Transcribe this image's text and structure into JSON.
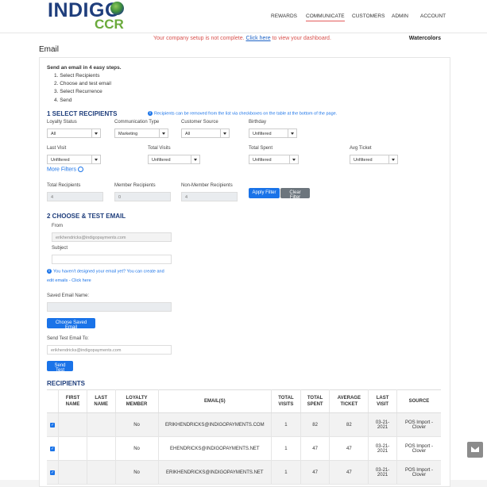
{
  "brand": {
    "name": "INDIGO",
    "sub": "CCR"
  },
  "nav": [
    {
      "label": "REWARDS"
    },
    {
      "label": "COMMUNICATE"
    },
    {
      "label": "CUSTOMERS"
    },
    {
      "label": "ADMIN"
    },
    {
      "label": "ACCOUNT"
    }
  ],
  "warning": {
    "text": "Your company setup is not complete.",
    "link": "Click here",
    "suffix": "to view your dashboard."
  },
  "company": "Watercolors",
  "page_title": "Email",
  "intro": {
    "heading": "Send an email in 4 easy steps.",
    "steps": [
      "1. Select Recipients",
      "2. Choose and test email",
      "3. Select Recurrence",
      "4. Send"
    ]
  },
  "section1": {
    "title": "1 SELECT RECIPIENTS",
    "note": "Recipients can be removed from the list via checkboxes on the table at the bottom of the page.",
    "filters": [
      {
        "label": "Loyalty Status",
        "value": "All"
      },
      {
        "label": "Communication Type",
        "value": "Marketing"
      },
      {
        "label": "Customer Source",
        "value": "All"
      },
      {
        "label": "Birthday",
        "value": "Unfiltered"
      },
      {
        "label": "Last Visit",
        "value": "Unfiltered"
      },
      {
        "label": "Total Visits",
        "value": "Unfiltered"
      },
      {
        "label": "Total Spent",
        "value": "Unfiltered"
      },
      {
        "label": "Avg Ticket",
        "value": "Unfiltered"
      }
    ],
    "more_filters": "More Filters",
    "counts": [
      {
        "label": "Total Recipients",
        "value": "4"
      },
      {
        "label": "Member Recipients",
        "value": "0"
      },
      {
        "label": "Non-Member Recipients",
        "value": "4"
      }
    ],
    "apply": "Apply Filter",
    "clear": "Clear Filter"
  },
  "section2": {
    "title": "2 CHOOSE & TEST EMAIL",
    "from_label": "From",
    "from_value": "erikhendricks@indigopayments.com",
    "subject_label": "Subject",
    "subject_value": "",
    "hint": "You haven't designed your email yet? You can create and",
    "hint2": "edit emails - Click here",
    "saved_label": "Saved Email Name:",
    "saved_value": "",
    "choose_btn": "Choose Saved Email",
    "test_label": "Send Test Email To:",
    "test_value": "erikhendricks@indigopayments.com",
    "send_test_btn": "Send Test"
  },
  "recipients": {
    "title": "RECIPIENTS",
    "columns": [
      "",
      "FIRST NAME",
      "LAST NAME",
      "LOYALTY MEMBER",
      "EMAIL(S)",
      "TOTAL VISITS",
      "TOTAL SPENT",
      "AVERAGE TICKET",
      "LAST VISIT",
      "SOURCE"
    ],
    "rows": [
      {
        "first": "",
        "last": "",
        "member": "No",
        "email": "ERIKHENDRICKS@INDIGOPAYMENTS.COM",
        "visits": "1",
        "spent": "82",
        "avg": "82",
        "last_visit": "03-21-2021",
        "source": "POS Import - Clover"
      },
      {
        "first": "",
        "last": "",
        "member": "No",
        "email": "EHENDRICKS@INDIGOPAYMENTS.NET",
        "visits": "1",
        "spent": "47",
        "avg": "47",
        "last_visit": "03-21-2021",
        "source": "POS Import - Clover"
      },
      {
        "first": "",
        "last": "",
        "member": "No",
        "email": "ERIKHENDRICKS@INDIGOPAYMENTS.NET",
        "visits": "1",
        "spent": "47",
        "avg": "47",
        "last_visit": "03-21-2021",
        "source": "POS Import - Clover"
      }
    ]
  },
  "colors": {
    "brand_blue": "#1f3e7c",
    "brand_green": "#6aaa3b",
    "accent": "#1a73e8",
    "warning": "#d9534f"
  }
}
